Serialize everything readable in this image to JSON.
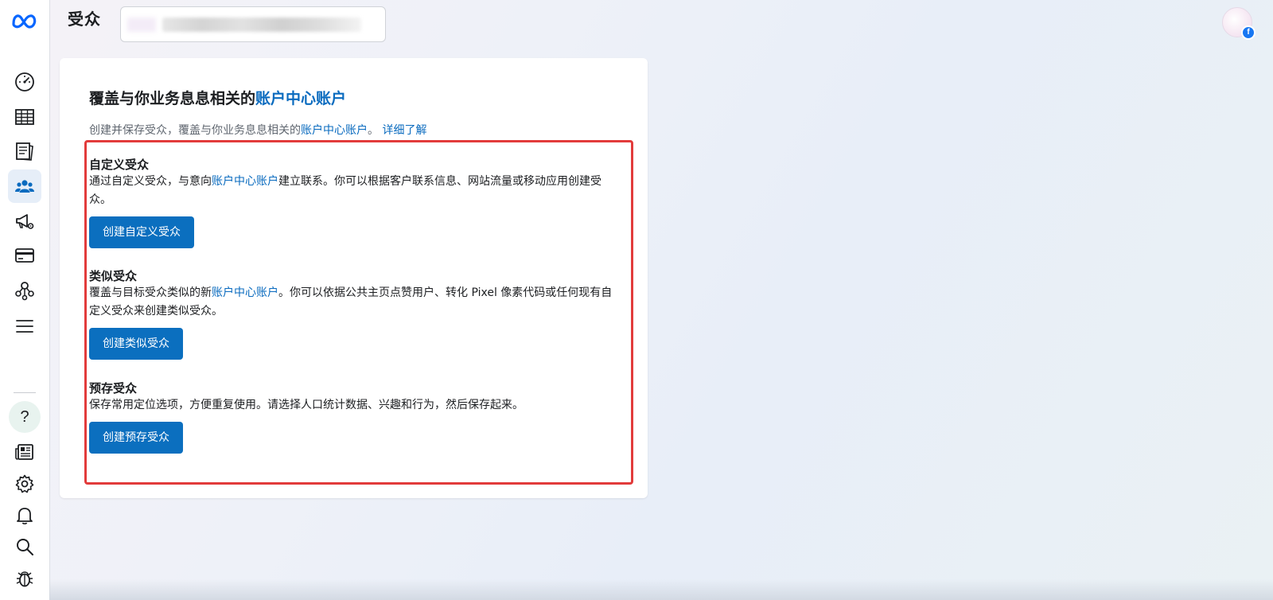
{
  "header": {
    "title": "受众"
  },
  "card": {
    "title_prefix": "覆盖与你业务息息相关的",
    "title_link": "账户中心账户",
    "subtitle_prefix": "创建并保存受众，覆盖与你业务息息相关的",
    "subtitle_link": "账户中心账户",
    "subtitle_mid": "。",
    "learn_more": "详细了解",
    "sections": [
      {
        "title": "自定义受众",
        "desc_prefix": "通过自定义受众，与意向",
        "desc_link": "账户中心账户",
        "desc_suffix": "建立联系。你可以根据客户联系信息、网站流量或移动应用创建受众。",
        "button": "创建自定义受众"
      },
      {
        "title": "类似受众",
        "desc_prefix": "覆盖与目标受众类似的新",
        "desc_link": "账户中心账户",
        "desc_suffix": "。你可以依据公共主页点赞用户、转化 Pixel 像素代码或任何现有自定义受众来创建类似受众。",
        "button": "创建类似受众"
      },
      {
        "title": "预存受众",
        "desc_prefix": "保存常用定位选项，方便重复使用。请选择人口统计数据、兴趣和行为，然后保存起来。",
        "desc_link": "",
        "desc_suffix": "",
        "button": "创建预存受众"
      }
    ]
  },
  "sidebar": {
    "items": [
      {
        "icon": "meta-logo-icon"
      },
      {
        "icon": "dashboard-gauge-icon"
      },
      {
        "icon": "table-icon"
      },
      {
        "icon": "pages-icon"
      },
      {
        "icon": "audience-people-icon",
        "active": true
      },
      {
        "icon": "megaphone-gear-icon"
      },
      {
        "icon": "credit-card-icon"
      },
      {
        "icon": "network-nodes-icon"
      },
      {
        "icon": "menu-icon"
      },
      {
        "icon": "help-icon",
        "glyph": "?"
      },
      {
        "icon": "news-icon"
      },
      {
        "icon": "settings-gear-icon"
      },
      {
        "icon": "bell-icon"
      },
      {
        "icon": "search-icon"
      },
      {
        "icon": "bug-icon"
      }
    ]
  },
  "avatar_badge": "f",
  "colors": {
    "accent_link": "#0a6bbf",
    "button_bg": "#0b6fbf",
    "highlight_border": "#e23b3b",
    "active_nav_bg": "#e6eef8",
    "meta_blue": "#0866ff"
  }
}
